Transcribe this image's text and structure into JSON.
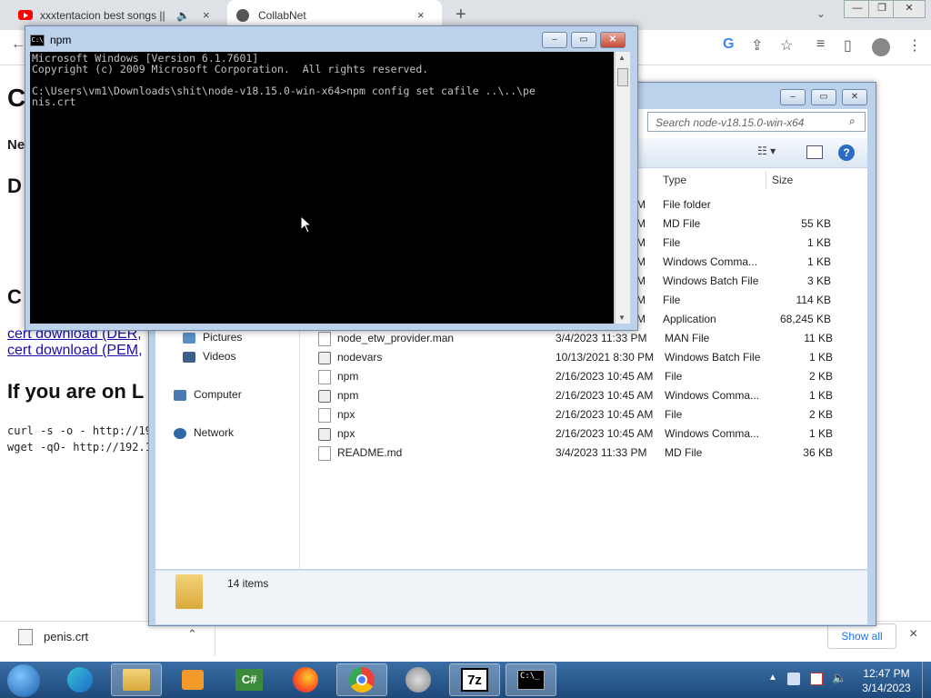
{
  "browser": {
    "tabs": [
      {
        "title": "xxxtentacion best songs || Be"
      },
      {
        "title": "CollabNet"
      }
    ],
    "new_tab": "+",
    "close": "×"
  },
  "page": {
    "h1_fragment": "C",
    "ne_fragment": "Ne",
    "d_fragment": "D",
    "c_fragment": "C",
    "links": [
      "cert download (DER, ",
      "cert download (PEM, "
    ],
    "heading": "If you are on L",
    "code": [
      "curl -s -o - http://19",
      "wget -qO- http://192.1"
    ]
  },
  "download_bar": {
    "file": "penis.crt",
    "show_all": "Show all",
    "close": "×"
  },
  "cmd": {
    "title": "npm",
    "icon_text": "C:\\",
    "lines": [
      "Microsoft Windows [Version 6.1.7601]",
      "Copyright (c) 2009 Microsoft Corporation.  All rights reserved.",
      "",
      "C:\\Users\\vm1\\Downloads\\shit\\node-v18.15.0-win-x64>npm config set cafile ..\\..\\pe",
      "nis.crt"
    ]
  },
  "explorer": {
    "search_placeholder": "Search node-v18.15.0-win-x64",
    "columns": {
      "type": "Type",
      "size": "Size"
    },
    "hidden_rows": [
      {
        "date_tail": "M",
        "type": "File folder",
        "size": ""
      },
      {
        "date_tail": "M",
        "type": "MD File",
        "size": "55 KB"
      },
      {
        "date_tail": "M",
        "type": "File",
        "size": "1 KB"
      },
      {
        "date_tail": "M",
        "type": "Windows Comma...",
        "size": "1 KB"
      },
      {
        "date_tail": "M",
        "type": "Windows Batch File",
        "size": "3 KB"
      },
      {
        "date_tail": "M",
        "type": "File",
        "size": "114 KB"
      },
      {
        "date_tail": "M",
        "type": "Application",
        "size": "68,245 KB"
      }
    ],
    "rows": [
      {
        "name": "node_etw_provider.man",
        "date": "3/4/2023 11:33 PM",
        "type": "MAN File",
        "size": "11 KB",
        "icon": "file"
      },
      {
        "name": "nodevars",
        "date": "10/13/2021 8:30 PM",
        "type": "Windows Batch File",
        "size": "1 KB",
        "icon": "gear"
      },
      {
        "name": "npm",
        "date": "2/16/2023 10:45 AM",
        "type": "File",
        "size": "2 KB",
        "icon": "file"
      },
      {
        "name": "npm",
        "date": "2/16/2023 10:45 AM",
        "type": "Windows Comma...",
        "size": "1 KB",
        "icon": "gear"
      },
      {
        "name": "npx",
        "date": "2/16/2023 10:45 AM",
        "type": "File",
        "size": "2 KB",
        "icon": "file"
      },
      {
        "name": "npx",
        "date": "2/16/2023 10:45 AM",
        "type": "Windows Comma...",
        "size": "1 KB",
        "icon": "gear"
      },
      {
        "name": "README.md",
        "date": "3/4/2023 11:33 PM",
        "type": "MD File",
        "size": "36 KB",
        "icon": "file"
      }
    ],
    "nav": [
      {
        "label": "Pictures",
        "icon": "pictures-icon"
      },
      {
        "label": "Videos",
        "icon": "videos-icon"
      },
      {
        "label": "Computer",
        "icon": "computer-icon"
      },
      {
        "label": "Network",
        "icon": "network-icon"
      }
    ],
    "status": "14 items"
  },
  "taskbar": {
    "time": "12:47 PM",
    "date": "3/14/2023",
    "cmd_icon_text": "C:\\_",
    "zip_icon_text": "7z",
    "csharp_icon_text": "C#"
  }
}
